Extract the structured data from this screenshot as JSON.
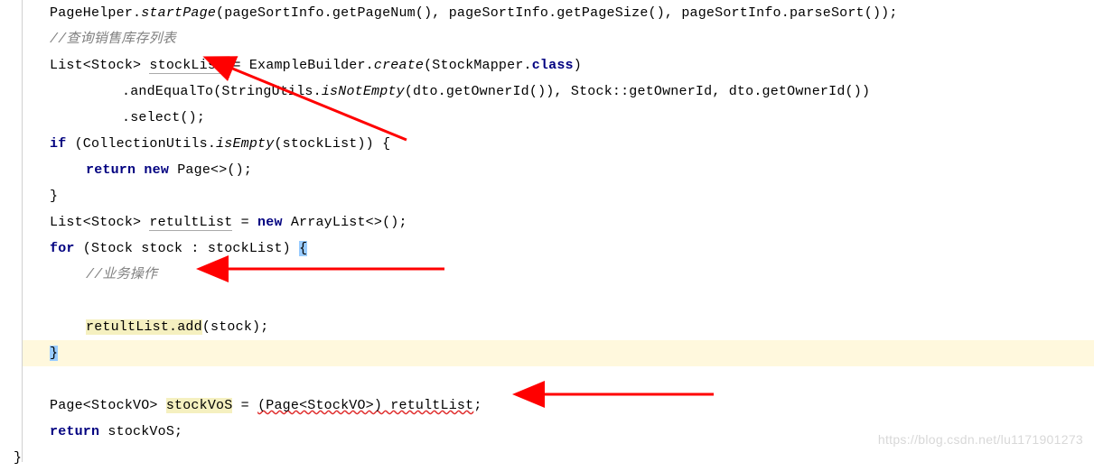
{
  "code": {
    "l1_a": "PageHelper.",
    "l1_b": "startPage",
    "l1_c": "(pageSortInfo.getPageNum(), pageSortInfo.getPageSize(), pageSortInfo.parseSort());",
    "l2": "//查询销售库存列表",
    "l3_a": "List<Stock> ",
    "l3_b": "stockList",
    "l3_c": " = ExampleBuilder.",
    "l3_d": "create",
    "l3_e": "(StockMapper.",
    "l3_f": "class",
    "l3_g": ")",
    "l4_a": ".andEqualTo(StringUtils.",
    "l4_b": "isNotEmpty",
    "l4_c": "(dto.getOwnerId()), Stock::getOwnerId, dto.getOwnerId())",
    "l5": ".select();",
    "l6_a": "if",
    "l6_b": " (CollectionUtils.",
    "l6_c": "isEmpty",
    "l6_d": "(stockList)) {",
    "l7_a": "return new",
    "l7_b": " Page<>();",
    "l8": "}",
    "l9_a": "List<Stock> ",
    "l9_b": "retultList",
    "l9_c": " = ",
    "l9_d": "new",
    "l9_e": " ArrayList<>();",
    "l10_a": "for",
    "l10_b": " (Stock stock : stockList) ",
    "l10_c": "{",
    "l11": "//业务操作",
    "l12_a": "retultList.add",
    "l12_b": "(stock);",
    "l13": "}",
    "l14_a": "Page<StockVO> ",
    "l14_b": "stockVoS",
    "l14_c": " = ",
    "l14_d": "(Page<StockVO>) retultList",
    "l14_e": ";",
    "l15_a": "return",
    "l15_b": " stockVoS;",
    "l16": "}"
  },
  "watermark": "https://blog.csdn.net/lu1171901273"
}
